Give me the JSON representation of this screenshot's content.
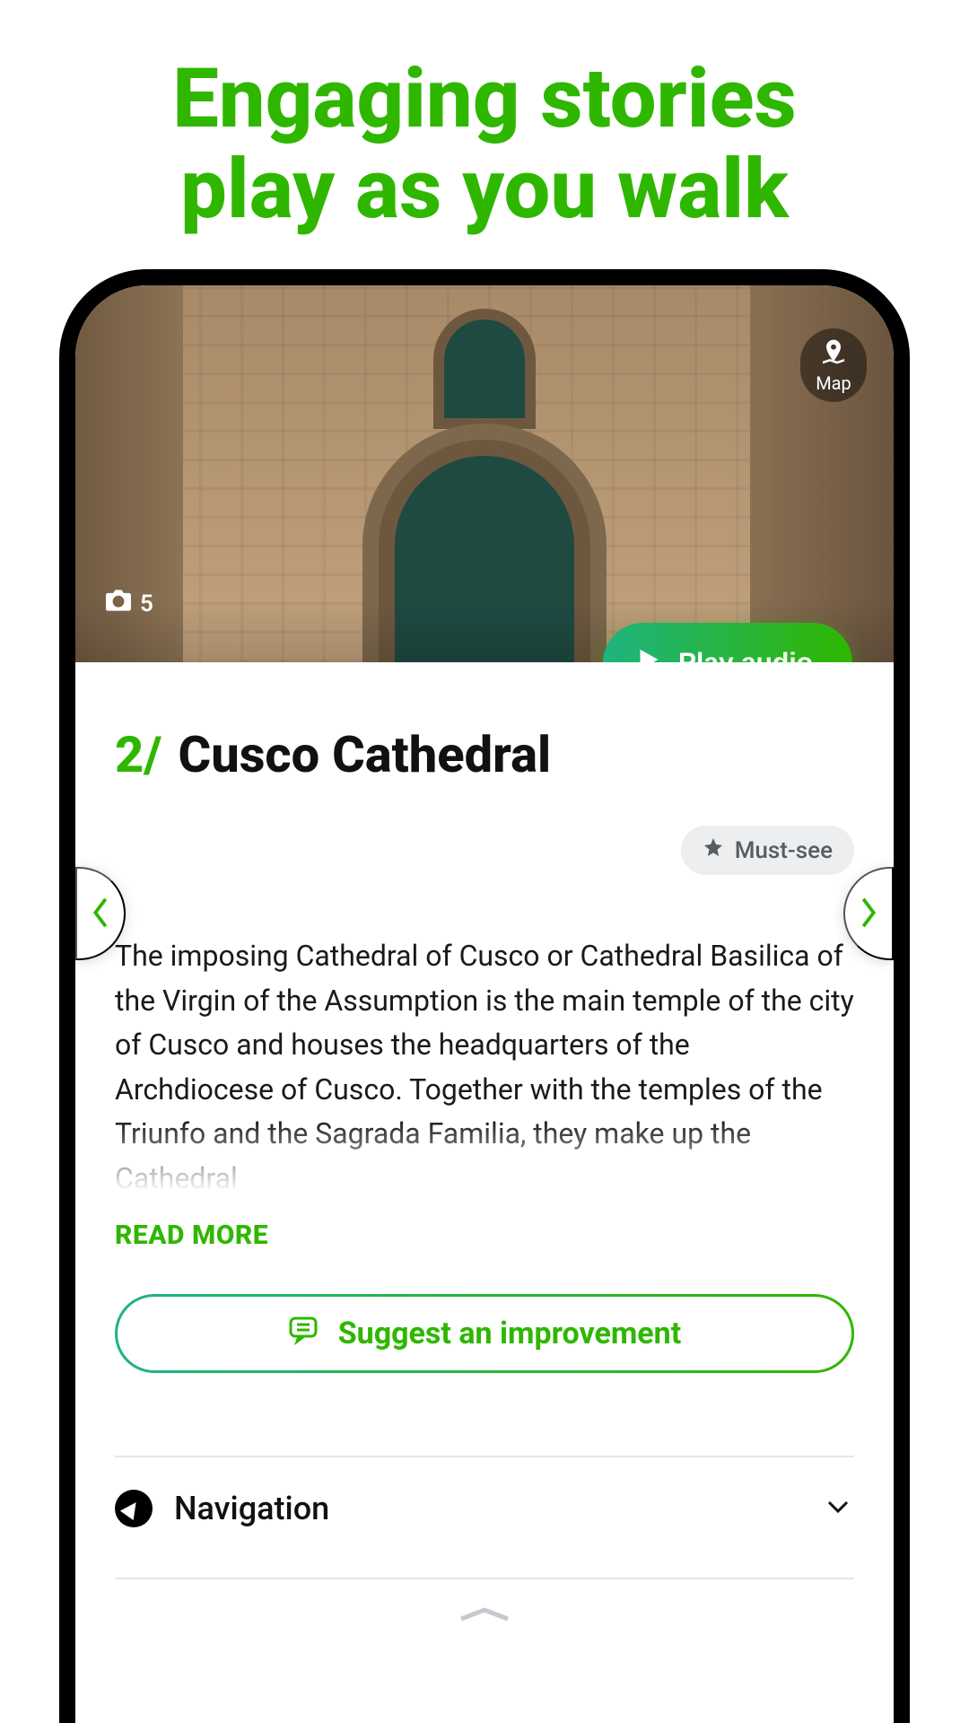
{
  "promo": {
    "headline_line1": "Engaging stories",
    "headline_line2": "play as you walk"
  },
  "colors": {
    "accent": "#2fb700",
    "accent2": "#1fb380"
  },
  "hero": {
    "photo_count": "5",
    "map_label": "Map",
    "play_label": "Play audio"
  },
  "stop": {
    "index_display": "2/",
    "name": "Cusco Cathedral",
    "tag": "Must-see",
    "description": "The imposing Cathedral of Cusco or Cathedral Basilica of the Virgin of the Assumption is the main temple of the city of Cusco and houses the headquarters of the Archdiocese of Cusco. Together with the temples of the Triunfo and the Sagrada Familia, they make up the Cathedral",
    "read_more_label": "READ MORE",
    "suggest_label": "Suggest an improvement"
  },
  "nav": {
    "section_label": "Navigation"
  }
}
